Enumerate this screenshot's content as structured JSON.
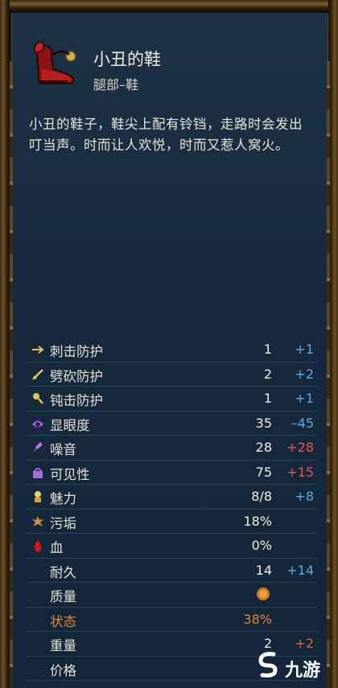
{
  "item": {
    "name": "小丑的鞋",
    "slot": "腿部–鞋",
    "description": "小丑的鞋子，鞋尖上配有铃铛，走路时会发出叮当声。时而让人欢悦，时而又惹人窝火。"
  },
  "stats": [
    {
      "label": "刺击防护",
      "value": "1",
      "mod": "+1",
      "mod_color": "blue",
      "icon": "thrust-icon"
    },
    {
      "label": "劈砍防护",
      "value": "2",
      "mod": "+2",
      "mod_color": "blue",
      "icon": "slash-icon"
    },
    {
      "label": "钝击防护",
      "value": "1",
      "mod": "+1",
      "mod_color": "blue",
      "icon": "blunt-icon"
    },
    {
      "label": "显眼度",
      "value": "35",
      "mod": "–45",
      "mod_color": "blue",
      "icon": "conspicuousness-icon"
    },
    {
      "label": "噪音",
      "value": "28",
      "mod": "+28",
      "mod_color": "red",
      "icon": "noise-icon"
    },
    {
      "label": "可见性",
      "value": "75",
      "mod": "+15",
      "mod_color": "red",
      "icon": "visibility-icon"
    },
    {
      "label": "魅力",
      "value": "8/8",
      "mod": "+8",
      "mod_color": "blue",
      "icon": "charisma-icon"
    },
    {
      "label": "污垢",
      "value": "18%",
      "mod": "",
      "mod_color": "",
      "icon": "dirt-icon"
    },
    {
      "label": "血",
      "value": "0%",
      "mod": "",
      "mod_color": "",
      "icon": "blood-icon"
    },
    {
      "label": "耐久",
      "value": "14",
      "mod": "+14",
      "mod_color": "blue",
      "icon": ""
    },
    {
      "label": "质量",
      "value": "",
      "mod": "",
      "mod_color": "",
      "icon": "",
      "quality_icon": "coin-icon"
    },
    {
      "label": "状态",
      "value": "38%",
      "mod": "",
      "mod_color": "",
      "icon": "",
      "warn": true
    },
    {
      "label": "重量",
      "value": "2",
      "mod": "+2",
      "mod_color": "red",
      "icon": ""
    },
    {
      "label": "价格",
      "value": "",
      "mod": "",
      "mod_color": "",
      "icon": ""
    }
  ],
  "watermark": {
    "text": "九游"
  },
  "colors": {
    "mod_blue": "#5fa8e6",
    "mod_red": "#e65a4a",
    "warn": "#e08a2e"
  }
}
